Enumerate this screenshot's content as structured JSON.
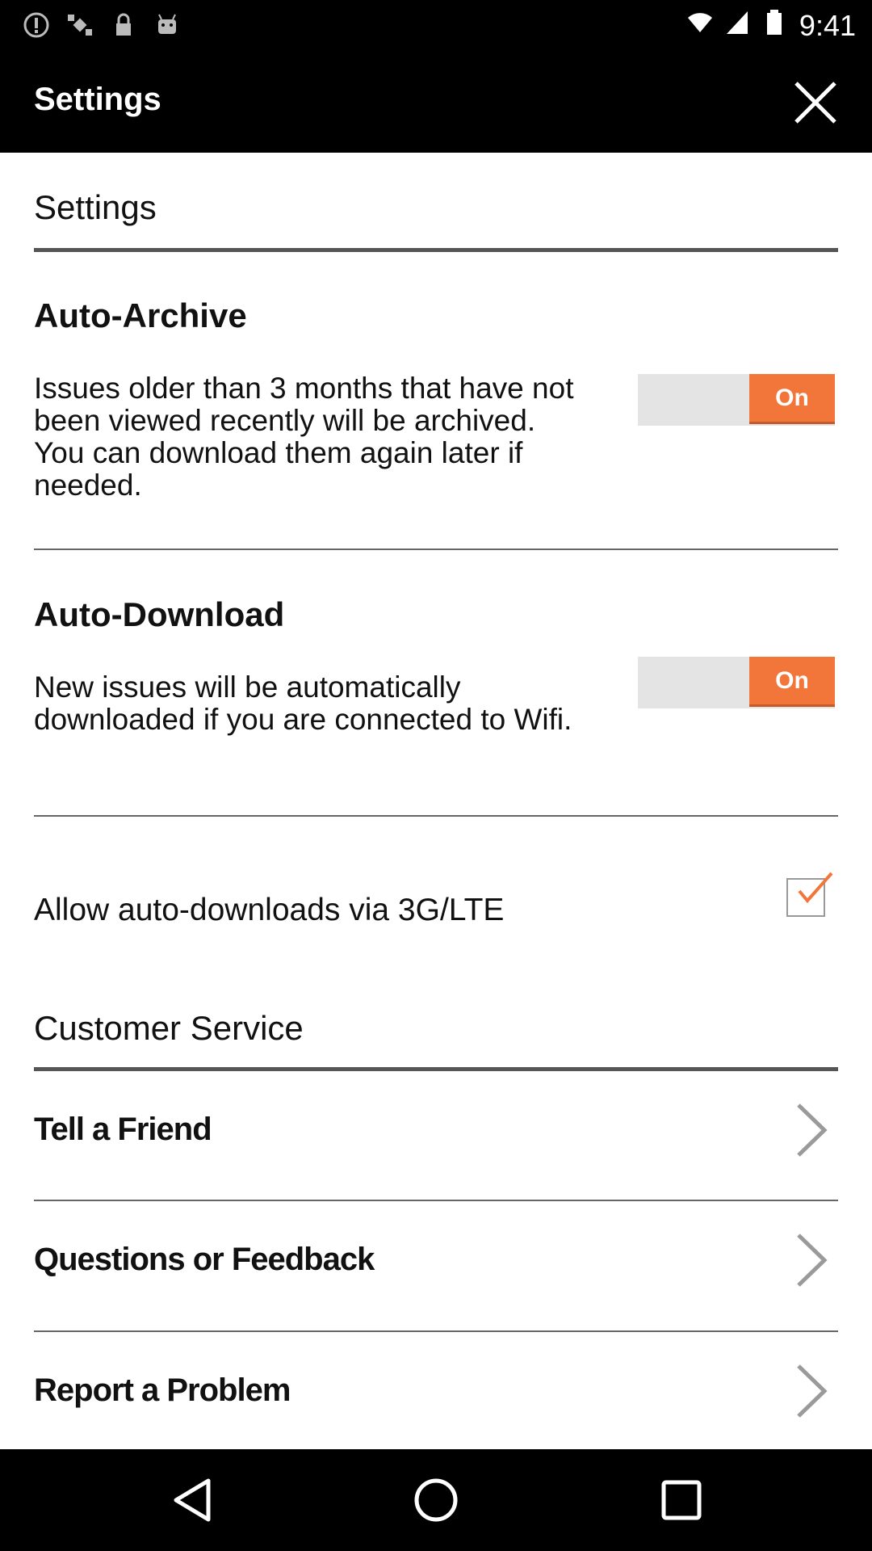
{
  "status_bar": {
    "time": "9:41",
    "icons": [
      "alert-icon",
      "fake-gps-icon",
      "lock-icon",
      "android-icon",
      "wifi-icon",
      "signal-icon",
      "battery-icon"
    ]
  },
  "app_bar": {
    "title": "Settings",
    "close_icon": "close-icon"
  },
  "settings_section": {
    "header": "Settings",
    "auto_archive": {
      "title": "Auto-Archive",
      "description": "Issues older than 3 months that have not been viewed recently will be archived. You can download them again later if needed.",
      "toggle_label": "On"
    },
    "auto_download": {
      "title": "Auto-Download",
      "description": "New issues will be automatically downloaded if you are connected to Wifi.",
      "toggle_label": "On"
    },
    "cellular": {
      "label": "Allow auto-downloads via 3G/LTE",
      "checked": true
    }
  },
  "customer_service": {
    "header": "Customer Service",
    "items": [
      {
        "label": "Tell a Friend"
      },
      {
        "label": "Questions or Feedback"
      },
      {
        "label": "Report a Problem"
      }
    ]
  },
  "colors": {
    "toggle_on": "#f2763a",
    "toggle_track": "#e4e4e4",
    "check": "#f2763a"
  },
  "nav_bar": {
    "icons": [
      "back-icon",
      "home-icon",
      "recents-icon"
    ]
  }
}
